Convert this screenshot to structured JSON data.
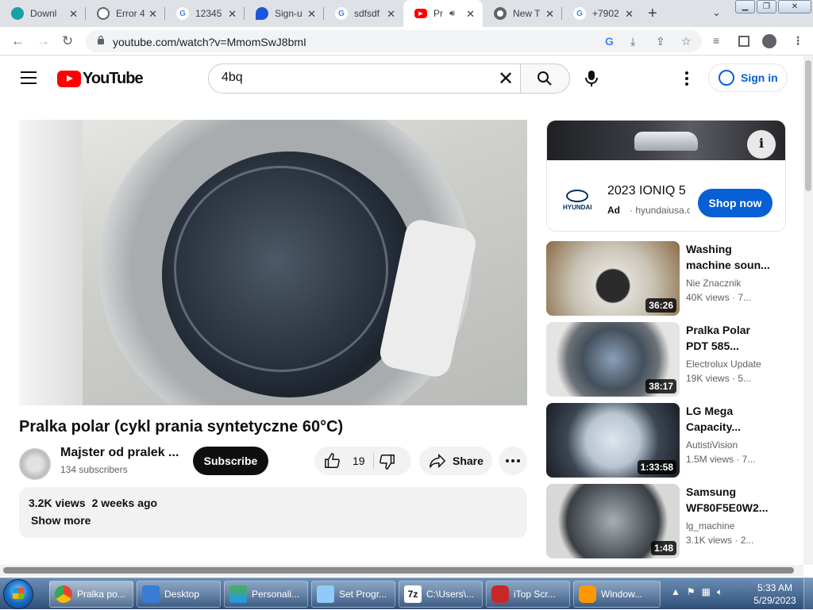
{
  "browser": {
    "tabs": [
      {
        "title": "Downl",
        "color": "#18a2a8",
        "glyph": ""
      },
      {
        "title": "Error 4",
        "color": "#5f6368",
        "glyph": ""
      },
      {
        "title": "12345",
        "color": "#4285f4",
        "glyph": "G"
      },
      {
        "title": "Sign-u",
        "color": "#1a56db",
        "glyph": ""
      },
      {
        "title": "sdfsdf",
        "color": "#4285f4",
        "glyph": "G"
      },
      {
        "title": "Pr",
        "color": "#ff0000",
        "glyph": "▶"
      },
      {
        "title": "New T",
        "color": "#5f6368",
        "glyph": ""
      },
      {
        "title": "+7902",
        "color": "#4285f4",
        "glyph": "G"
      }
    ],
    "url": "youtube.com/watch?v=MmomSwJ8bmI"
  },
  "youtube": {
    "logo_text": "YouTube",
    "search_value": "4bq",
    "sign_in": "Sign in",
    "video": {
      "title": "Pralka polar (cykl prania syntetyczne 60°C)",
      "channel": "Majster od pralek ...",
      "subscribers": "134 subscribers",
      "subscribe_label": "Subscribe",
      "likes": "19",
      "share_label": "Share",
      "views": "3.2K views",
      "age": "2 weeks ago",
      "show_more": "Show more"
    },
    "ad": {
      "title": "2023 IONIQ 5",
      "ad_label": "Ad",
      "domain": "· hyundaiusa.com",
      "cta": "Shop now",
      "brand": "HYUNDAI"
    },
    "related": [
      {
        "title1": "Washing",
        "title2": "machine soun...",
        "channel": "Nie Znacznik",
        "meta": "40K views · 7...",
        "duration": "36:26"
      },
      {
        "title1": "Pralka Polar",
        "title2": "PDT 585...",
        "channel": "Electrolux Update",
        "meta": "19K views · 5...",
        "duration": "38:17"
      },
      {
        "title1": "LG Mega",
        "title2": "Capacity...",
        "channel": "AutistiVision",
        "meta": "1.5M views · 7...",
        "duration": "1:33:58"
      },
      {
        "title1": "Samsung",
        "title2": "WF80F5E0W2...",
        "channel": "lg_machine",
        "meta": "3.1K views · 2...",
        "duration": "1:48"
      }
    ]
  },
  "taskbar": {
    "items": [
      {
        "label": "Pralka po...",
        "color": "#ea4335"
      },
      {
        "label": "Desktop",
        "color": "#3a7bd5"
      },
      {
        "label": "Personali...",
        "color": "#4caf50"
      },
      {
        "label": "Set Progr...",
        "color": "#90caf9"
      },
      {
        "label": "C:\\Users\\...",
        "color": "#111111"
      },
      {
        "label": "iTop Scr...",
        "color": "#c62828"
      },
      {
        "label": "Window...",
        "color": "#ff9800"
      }
    ],
    "time": "5:33 AM",
    "date": "5/29/2023"
  }
}
